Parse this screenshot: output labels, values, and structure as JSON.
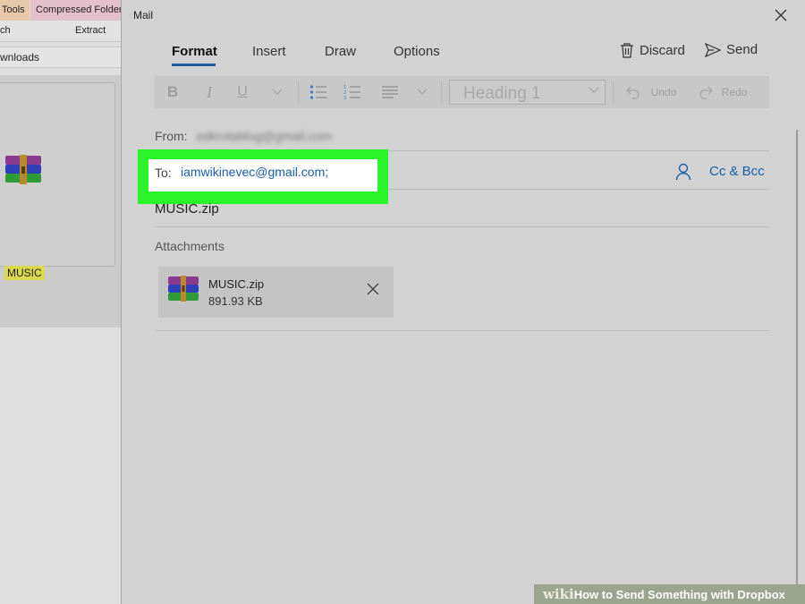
{
  "explorer": {
    "ribbon_tabs": [
      "Tools",
      "Compressed Folder"
    ],
    "ribbon_actions": [
      "ch",
      "Extract"
    ],
    "address": "wnloads",
    "folder": {
      "label": "MUSIC",
      "icon": "winrar-archive-icon"
    }
  },
  "mail": {
    "title": "Mail",
    "tabs": [
      "Format",
      "Insert",
      "Draw",
      "Options"
    ],
    "active_tab": "Format",
    "actions": {
      "discard": "Discard",
      "send": "Send"
    },
    "toolbar": {
      "bold": "B",
      "italic": "I",
      "underline": "U",
      "style_select": "Heading 1",
      "undo": "Undo",
      "redo": "Redo"
    },
    "from": {
      "label": "From:",
      "value": "edkrotablog@gmail.com"
    },
    "to": {
      "label": "To:",
      "value": "iamwikinevec@gmail.com;"
    },
    "cc_bcc": "Cc & Bcc",
    "subject": "MUSIC.zip",
    "attachments_heading": "Attachments",
    "attachment": {
      "name": "MUSIC.zip",
      "size": "891.93 KB",
      "icon": "winrar-archive-icon"
    },
    "colors": {
      "accent": "#1e5aa0",
      "highlight": "#2af52a",
      "link": "#1a5ea8"
    }
  },
  "watermark": {
    "wiki": "wiki",
    "how": "How",
    "rest": " to Send Something with Dropbox"
  }
}
